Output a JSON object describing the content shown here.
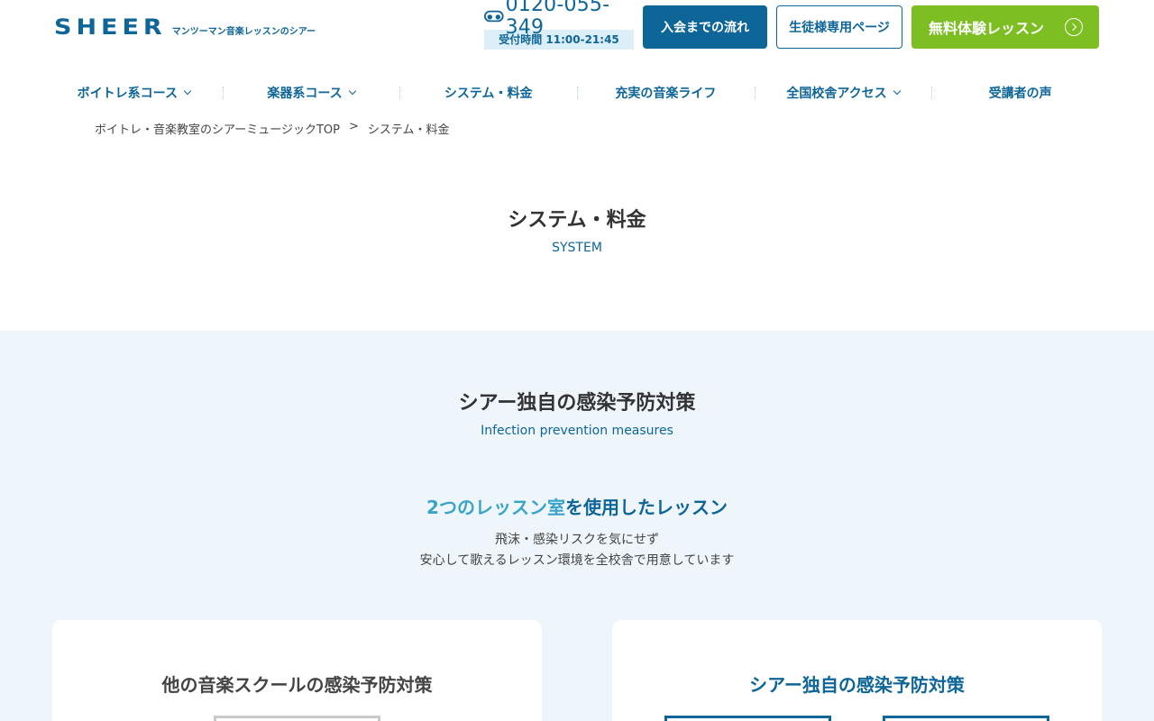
{
  "header": {
    "logo_text": "SHEER",
    "logo_tagline": "マンツーマン音楽レッスンのシアー",
    "phone_number": "0120-055-349",
    "hours": "受付時間 11:00-21:45",
    "btn_flow": "入会までの流れ",
    "btn_student": "生徒様専用ページ",
    "btn_trial": "無料体験レッスン"
  },
  "nav": {
    "items": [
      {
        "label": "ボイトレ系コース"
      },
      {
        "label": "楽器系コース"
      },
      {
        "label": "システム・料金"
      },
      {
        "label": "充実の音楽ライフ"
      },
      {
        "label": "全国校舎アクセス"
      },
      {
        "label": "受講者の声"
      }
    ]
  },
  "breadcrumb": {
    "home": "ボイトレ・音楽教室のシアーミュージックTOP",
    "sep": ">",
    "current": "システム・料金"
  },
  "page": {
    "title": "システム・料金",
    "subtitle": "SYSTEM"
  },
  "section": {
    "title": "シアー独自の感染予防対策",
    "subtitle": "Infection prevention measures",
    "headline_highlight": "2つのレッスン室",
    "headline_rest": "を使用したレッスン",
    "desc_line1": "飛沫・感染リスクを気にせず",
    "desc_line2": "安心して歌えるレッスン環境を全校舎で用意しています",
    "card_left_title": "他の音楽スクールの感染予防対策",
    "card_right_title": "シアー独自の感染予防対策"
  },
  "colors": {
    "brand": "#0e6598",
    "accent_green": "#7dbe23",
    "highlight": "#3aa4c8",
    "section_bg": "#eef5fb"
  },
  "icons": {
    "phone": "free-dial-icon",
    "chevron": "chevron-down-icon",
    "arrow": "arrow-right-circle-icon"
  }
}
